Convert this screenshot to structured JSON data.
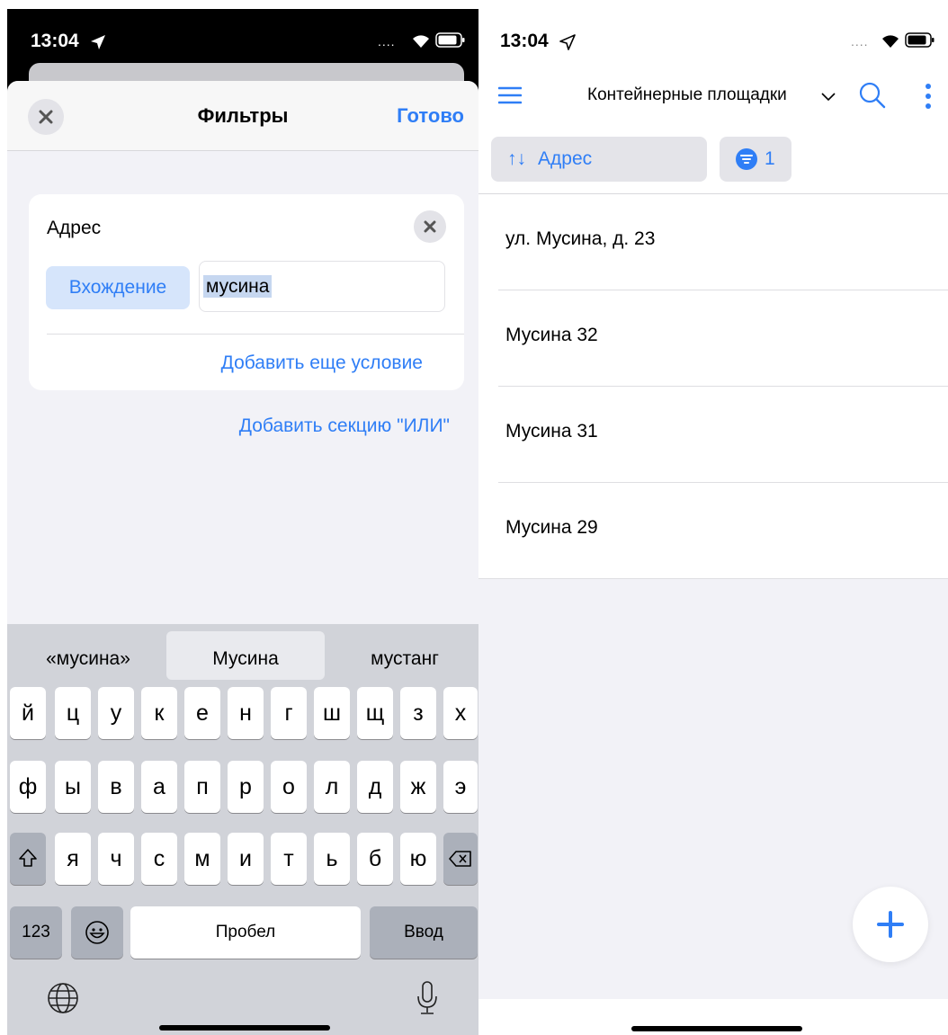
{
  "left": {
    "status": {
      "time": "13:04"
    },
    "sheet": {
      "title": "Фильтры",
      "done_label": "Готово",
      "close_icon": "close-icon"
    },
    "filter": {
      "field_label": "Адрес",
      "mode_label": "Вхождение",
      "value": "мусина",
      "add_condition_label": "Добавить еще условие"
    },
    "add_or_section_label": "Добавить секцию \"ИЛИ\"",
    "keyboard": {
      "suggestions": [
        "«мусина»",
        "Мусина",
        "мустанг"
      ],
      "row1": [
        "й",
        "ц",
        "у",
        "к",
        "е",
        "н",
        "г",
        "ш",
        "щ",
        "з",
        "х"
      ],
      "row2": [
        "ф",
        "ы",
        "в",
        "а",
        "п",
        "р",
        "о",
        "л",
        "д",
        "ж",
        "э"
      ],
      "row3": [
        "я",
        "ч",
        "с",
        "м",
        "и",
        "т",
        "ь",
        "б",
        "ю"
      ],
      "numbers_label": "123",
      "space_label": "Пробел",
      "return_label": "Ввод"
    }
  },
  "right": {
    "status": {
      "time": "13:04"
    },
    "nav": {
      "title": "Контейнерные площадки"
    },
    "sort_chip": {
      "icon": "↑↓",
      "label": "Адрес"
    },
    "filter_chip": {
      "count": "1"
    },
    "items": [
      "ул. Мусина, д. 23",
      "Мусина 32",
      "Мусина 31",
      "Мусина 29"
    ]
  },
  "colors": {
    "accent": "#2f7ef6",
    "chip_bg": "#d6e5fb",
    "keyboard_bg": "#d1d3d9"
  }
}
